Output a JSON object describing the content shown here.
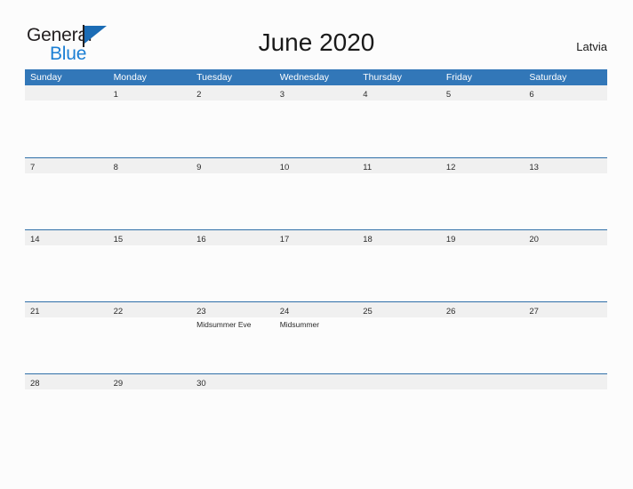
{
  "brand": {
    "name_part1": "General",
    "name_part2": "Blue",
    "flag_icon": "blue-triangle-flag-icon",
    "color_dark": "#231f20",
    "color_blue": "#1b7fd4"
  },
  "header": {
    "title": "June 2020",
    "country": "Latvia"
  },
  "theme": {
    "header_blue": "#3277b8",
    "row_divider_blue": "#2f6fa8",
    "day_band_gray": "#f0f0f0",
    "page_background": "#fcfcfc"
  },
  "calendar": {
    "month": "June",
    "year": "2020",
    "weekdays": [
      "Sunday",
      "Monday",
      "Tuesday",
      "Wednesday",
      "Thursday",
      "Friday",
      "Saturday"
    ],
    "weeks": [
      [
        {
          "day": "",
          "event": ""
        },
        {
          "day": "1",
          "event": ""
        },
        {
          "day": "2",
          "event": ""
        },
        {
          "day": "3",
          "event": ""
        },
        {
          "day": "4",
          "event": ""
        },
        {
          "day": "5",
          "event": ""
        },
        {
          "day": "6",
          "event": ""
        }
      ],
      [
        {
          "day": "7",
          "event": ""
        },
        {
          "day": "8",
          "event": ""
        },
        {
          "day": "9",
          "event": ""
        },
        {
          "day": "10",
          "event": ""
        },
        {
          "day": "11",
          "event": ""
        },
        {
          "day": "12",
          "event": ""
        },
        {
          "day": "13",
          "event": ""
        }
      ],
      [
        {
          "day": "14",
          "event": ""
        },
        {
          "day": "15",
          "event": ""
        },
        {
          "day": "16",
          "event": ""
        },
        {
          "day": "17",
          "event": ""
        },
        {
          "day": "18",
          "event": ""
        },
        {
          "day": "19",
          "event": ""
        },
        {
          "day": "20",
          "event": ""
        }
      ],
      [
        {
          "day": "21",
          "event": ""
        },
        {
          "day": "22",
          "event": ""
        },
        {
          "day": "23",
          "event": "Midsummer Eve"
        },
        {
          "day": "24",
          "event": "Midsummer"
        },
        {
          "day": "25",
          "event": ""
        },
        {
          "day": "26",
          "event": ""
        },
        {
          "day": "27",
          "event": ""
        }
      ],
      [
        {
          "day": "28",
          "event": ""
        },
        {
          "day": "29",
          "event": ""
        },
        {
          "day": "30",
          "event": ""
        },
        {
          "day": "",
          "event": ""
        },
        {
          "day": "",
          "event": ""
        },
        {
          "day": "",
          "event": ""
        },
        {
          "day": "",
          "event": ""
        }
      ]
    ]
  }
}
